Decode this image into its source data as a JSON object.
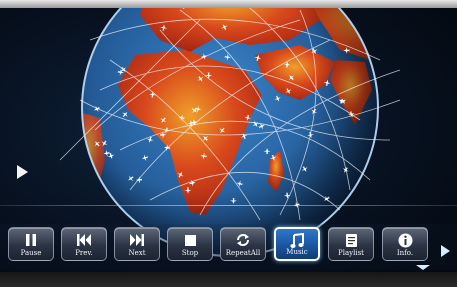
{
  "controls": [
    {
      "label": "Pause",
      "icon": "pause-icon"
    },
    {
      "label": "Prev.",
      "icon": "previous-icon"
    },
    {
      "label": "Next",
      "icon": "next-icon"
    },
    {
      "label": "Stop",
      "icon": "stop-icon"
    },
    {
      "label": "RepeatAll",
      "icon": "repeat-icon"
    },
    {
      "label": "Music",
      "icon": "music-note-icon",
      "active": true
    },
    {
      "label": "Playlist",
      "icon": "playlist-icon"
    },
    {
      "label": "Info.",
      "icon": "info-icon"
    }
  ],
  "colors": {
    "button_active": "#1a56a0",
    "button_idle": "#2b3444",
    "globe_land": "#c8361a",
    "globe_ocean": "#2f6fb4",
    "flight_path": "#f2f4f8"
  }
}
